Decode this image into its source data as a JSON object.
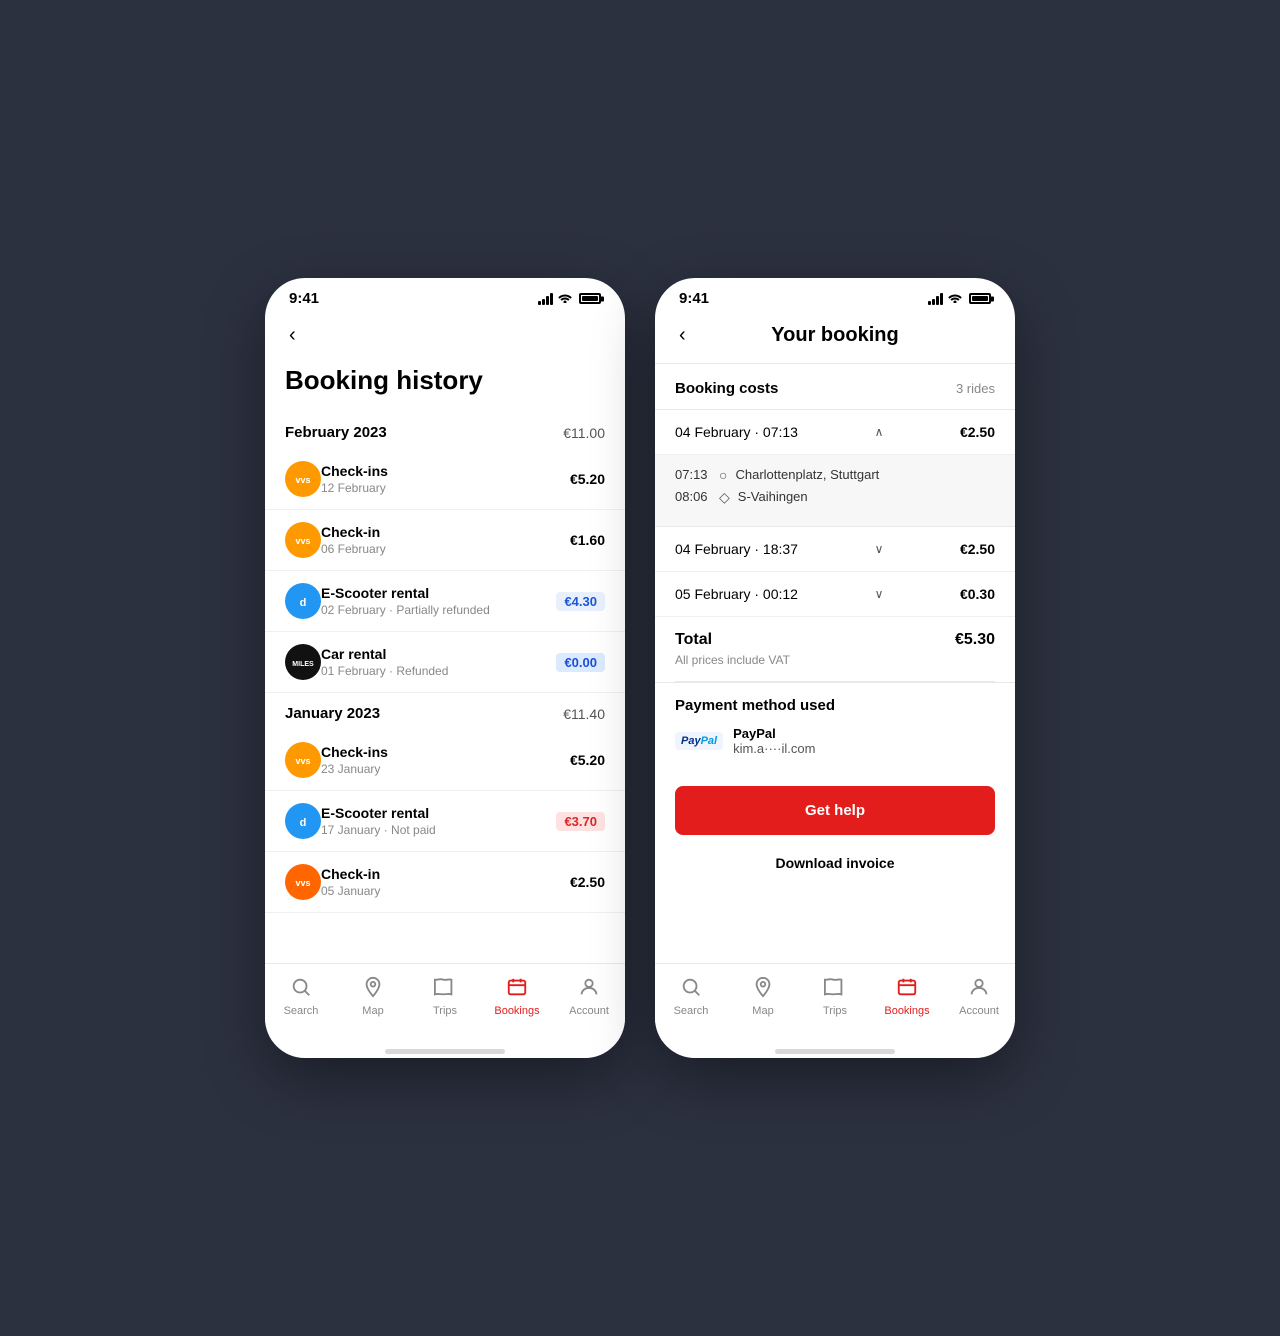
{
  "phone1": {
    "statusBar": {
      "time": "9:41"
    },
    "header": {
      "back": "‹",
      "title": "Booking history"
    },
    "sections": [
      {
        "id": "feb2023",
        "label": "February 2023",
        "total": "€11.00",
        "items": [
          {
            "id": "item1",
            "iconType": "vvs-orange",
            "name": "Check-ins",
            "date": "12 February",
            "amount": "€5.20",
            "badge": false,
            "badgeColor": ""
          },
          {
            "id": "item2",
            "iconType": "vvs-orange",
            "name": "Check-in",
            "date": "06 February",
            "amount": "€1.60",
            "badge": false,
            "badgeColor": ""
          },
          {
            "id": "item3",
            "iconType": "dott",
            "name": "E-Scooter rental",
            "date": "02 February · Partially refunded",
            "amount": "€4.30",
            "badge": true,
            "badgeColor": "blue"
          },
          {
            "id": "item4",
            "iconType": "miles",
            "name": "Car rental",
            "date": "01 February · Refunded",
            "amount": "€0.00",
            "badge": true,
            "badgeColor": "blue-light"
          }
        ]
      },
      {
        "id": "jan2023",
        "label": "January 2023",
        "total": "€11.40",
        "items": [
          {
            "id": "item5",
            "iconType": "vvs-orange",
            "name": "Check-ins",
            "date": "23 January",
            "amount": "€5.20",
            "badge": false,
            "badgeColor": ""
          },
          {
            "id": "item6",
            "iconType": "dott",
            "name": "E-Scooter rental",
            "date": "17 January · Not paid",
            "amount": "€3.70",
            "badge": true,
            "badgeColor": "red"
          },
          {
            "id": "item7",
            "iconType": "vvs-orange-2",
            "name": "Check-in",
            "date": "05 January",
            "amount": "€2.50",
            "badge": false,
            "badgeColor": ""
          }
        ]
      }
    ],
    "bottomNav": [
      {
        "id": "search",
        "label": "Search",
        "icon": "search",
        "active": false
      },
      {
        "id": "map",
        "label": "Map",
        "icon": "map",
        "active": false
      },
      {
        "id": "trips",
        "label": "Trips",
        "icon": "trips",
        "active": false
      },
      {
        "id": "bookings",
        "label": "Bookings",
        "icon": "bookings",
        "active": true
      },
      {
        "id": "account",
        "label": "Account",
        "icon": "account",
        "active": false
      }
    ]
  },
  "phone2": {
    "statusBar": {
      "time": "9:41"
    },
    "header": {
      "back": "‹",
      "title": "Your booking"
    },
    "bookingCosts": {
      "label": "Booking costs",
      "rides": "3 rides",
      "rides_label": "rides"
    },
    "rides": [
      {
        "id": "ride1",
        "date": "04 February · 07:13",
        "amount": "€2.50",
        "expanded": true,
        "chevron": "∧",
        "stops": [
          {
            "time": "07:13",
            "icon": "○",
            "location": "Charlottenplatz, Stuttgart"
          },
          {
            "time": "08:06",
            "icon": "◇",
            "location": "S-Vaihingen"
          }
        ]
      },
      {
        "id": "ride2",
        "date": "04 February · 18:37",
        "amount": "€2.50",
        "expanded": false,
        "chevron": "∨"
      },
      {
        "id": "ride3",
        "date": "05 February · 00:12",
        "amount": "€0.30",
        "expanded": false,
        "chevron": "∨"
      }
    ],
    "total": {
      "label": "Total",
      "amount": "€5.30",
      "vat_note": "All prices include VAT"
    },
    "payment": {
      "title": "Payment method used",
      "method": "PayPal",
      "email": "kim.a····il.com"
    },
    "getHelp": "Get help",
    "downloadInvoice": "Download invoice",
    "bottomNav": [
      {
        "id": "search",
        "label": "Search",
        "icon": "search",
        "active": false
      },
      {
        "id": "map",
        "label": "Map",
        "icon": "map",
        "active": false
      },
      {
        "id": "trips",
        "label": "Trips",
        "icon": "trips",
        "active": false
      },
      {
        "id": "bookings",
        "label": "Bookings",
        "icon": "bookings",
        "active": true
      },
      {
        "id": "account",
        "label": "Account",
        "icon": "account",
        "active": false
      }
    ]
  }
}
